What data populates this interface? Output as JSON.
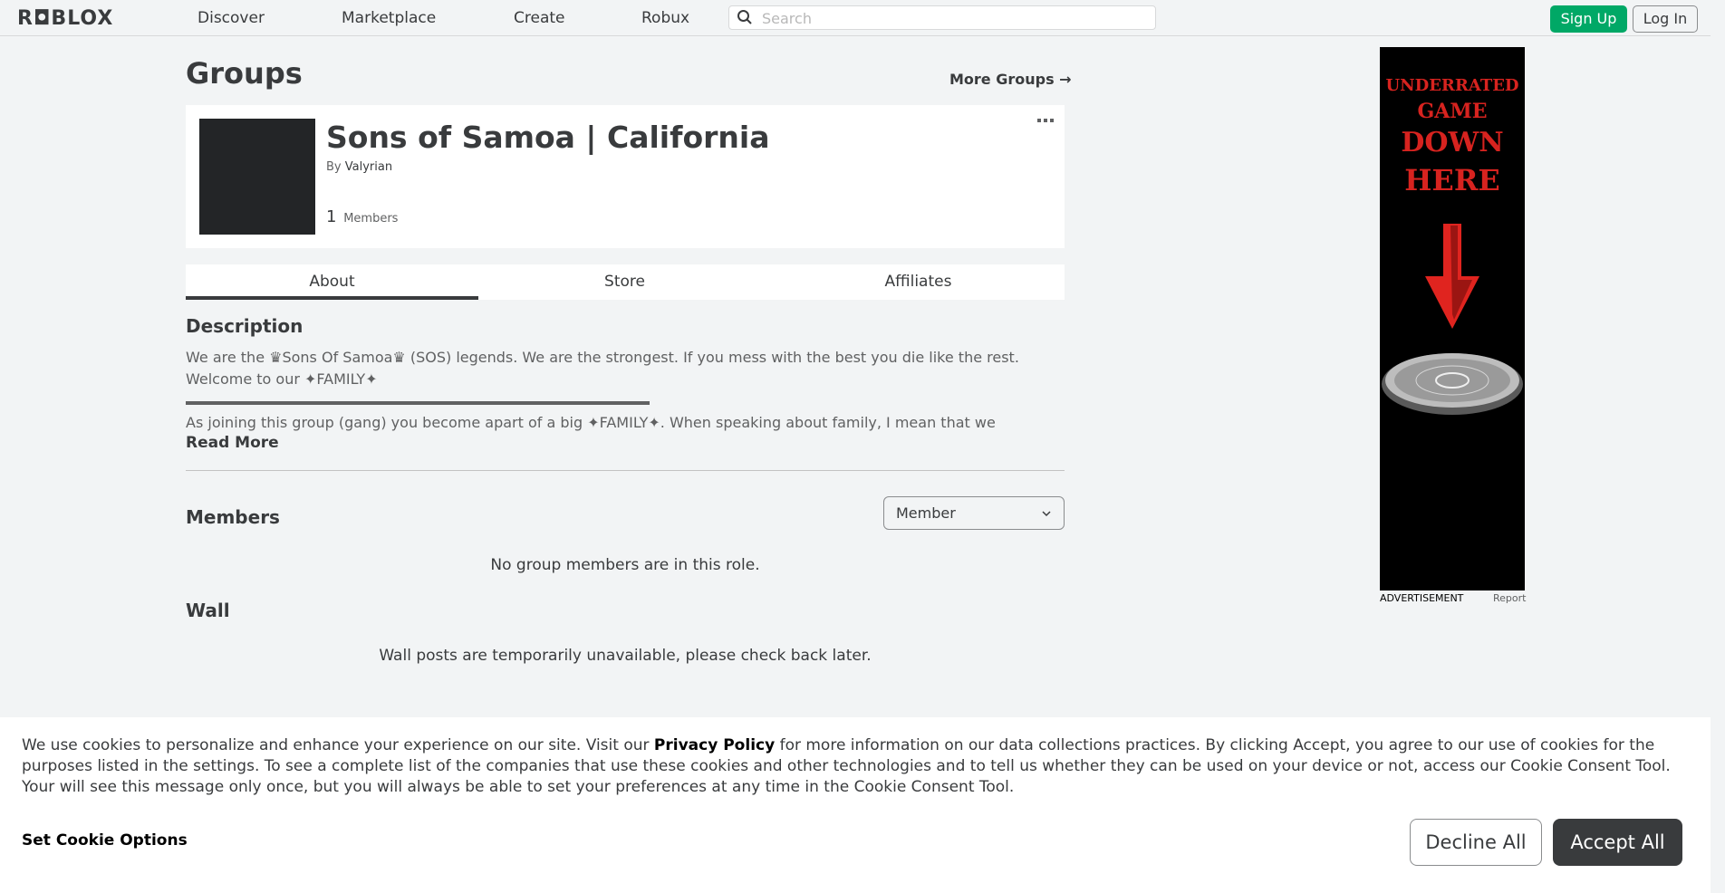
{
  "nav": {
    "logo": "R◘BLOX",
    "links": [
      "Discover",
      "Marketplace",
      "Create",
      "Robux"
    ],
    "search_placeholder": "Search",
    "signup_label": "Sign Up",
    "login_label": "Log In"
  },
  "page": {
    "title": "Groups",
    "more_groups": "More Groups →"
  },
  "group": {
    "name": "Sons of Samoa | California",
    "owner_prefix": "By",
    "owner_name": "Valyrian",
    "member_count": "1",
    "member_label": "Members"
  },
  "tabs": [
    "About",
    "Store",
    "Affiliates"
  ],
  "about": {
    "description_title": "Description",
    "description_line1": "We are the ♛Sons Of Samoa♛ (SOS) legends. We are the strongest. If you mess with the best you die like the rest.",
    "description_line2": "Welcome to our ✦FAMILY✦",
    "description_line3": "As joining this group (gang) you become apart of a big ✦FAMILY✦. When speaking about family, I mean that we",
    "read_more": "Read More",
    "members_title": "Members",
    "role_selected": "Member",
    "no_members": "No group members are in this role.",
    "wall_title": "Wall",
    "wall_message": "Wall posts are temporarily unavailable, please check back later."
  },
  "ad": {
    "line1": "UNDERRATED",
    "line2": "GAME",
    "line3": "DOWN",
    "line4": "HERE",
    "label": "ADVERTISEMENT",
    "report": "Report"
  },
  "cookie": {
    "text_before": "We use cookies to personalize and enhance your experience on our site. Visit our",
    "privacy_link": "Privacy Policy",
    "text_after": "for more information on our data collections practices. By clicking Accept, you agree to our use of cookies for the purposes listed in the settings. To see a complete list of the companies that use these cookies and other technologies and to tell us whether they can be used on your device or not, access our Cookie Consent Tool. Your will see this message only once, but you will always be able to set your preferences at any time in the Cookie Consent Tool.",
    "set_options": "Set Cookie Options",
    "decline": "Decline All",
    "accept": "Accept All"
  },
  "colors": {
    "signup_green": "#00a866",
    "text_dark": "#393b3d",
    "ad_red": "#d7231f"
  }
}
